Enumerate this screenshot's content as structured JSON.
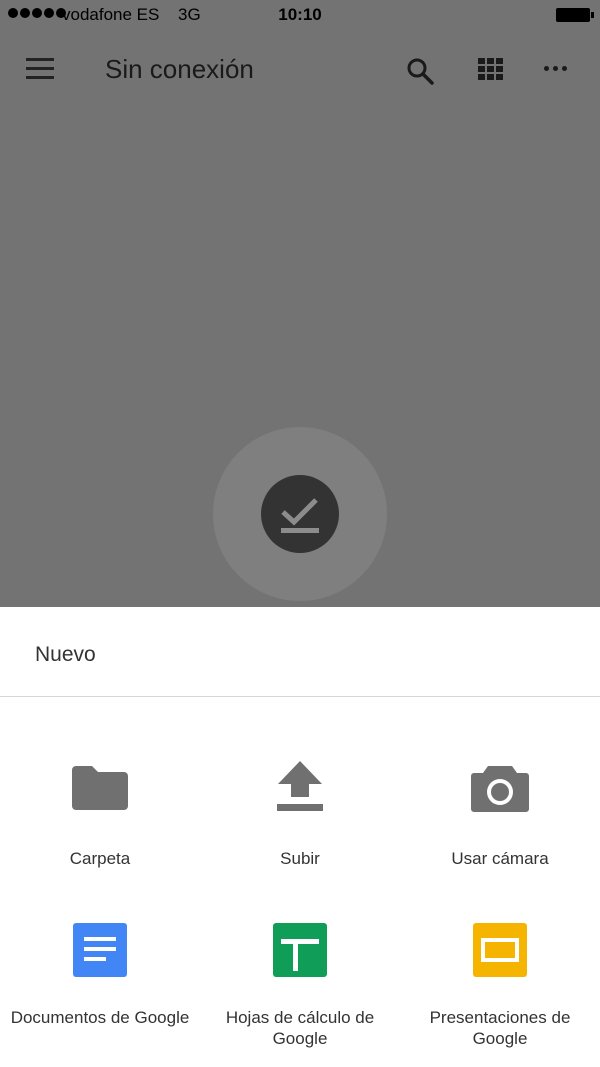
{
  "status_bar": {
    "carrier": "vodafone ES",
    "network": "3G",
    "time": "10:10"
  },
  "app_bar": {
    "title": "Sin conexión"
  },
  "sheet": {
    "title": "Nuevo",
    "options_row1": [
      {
        "label": "Carpeta",
        "icon": "folder-icon"
      },
      {
        "label": "Subir",
        "icon": "upload-icon"
      },
      {
        "label": "Usar cámara",
        "icon": "camera-icon"
      }
    ],
    "options_row2": [
      {
        "label": "Documentos de Google",
        "icon": "google-docs-icon",
        "color": "#4285F4"
      },
      {
        "label": "Hojas de cálculo de Google",
        "icon": "google-sheets-icon",
        "color": "#0F9D58"
      },
      {
        "label": "Presentaciones de Google",
        "icon": "google-slides-icon",
        "color": "#F4B400"
      }
    ]
  },
  "colors": {
    "scrim": "#737373",
    "icon_grey": "#707070",
    "offline_badge": "#333333"
  }
}
